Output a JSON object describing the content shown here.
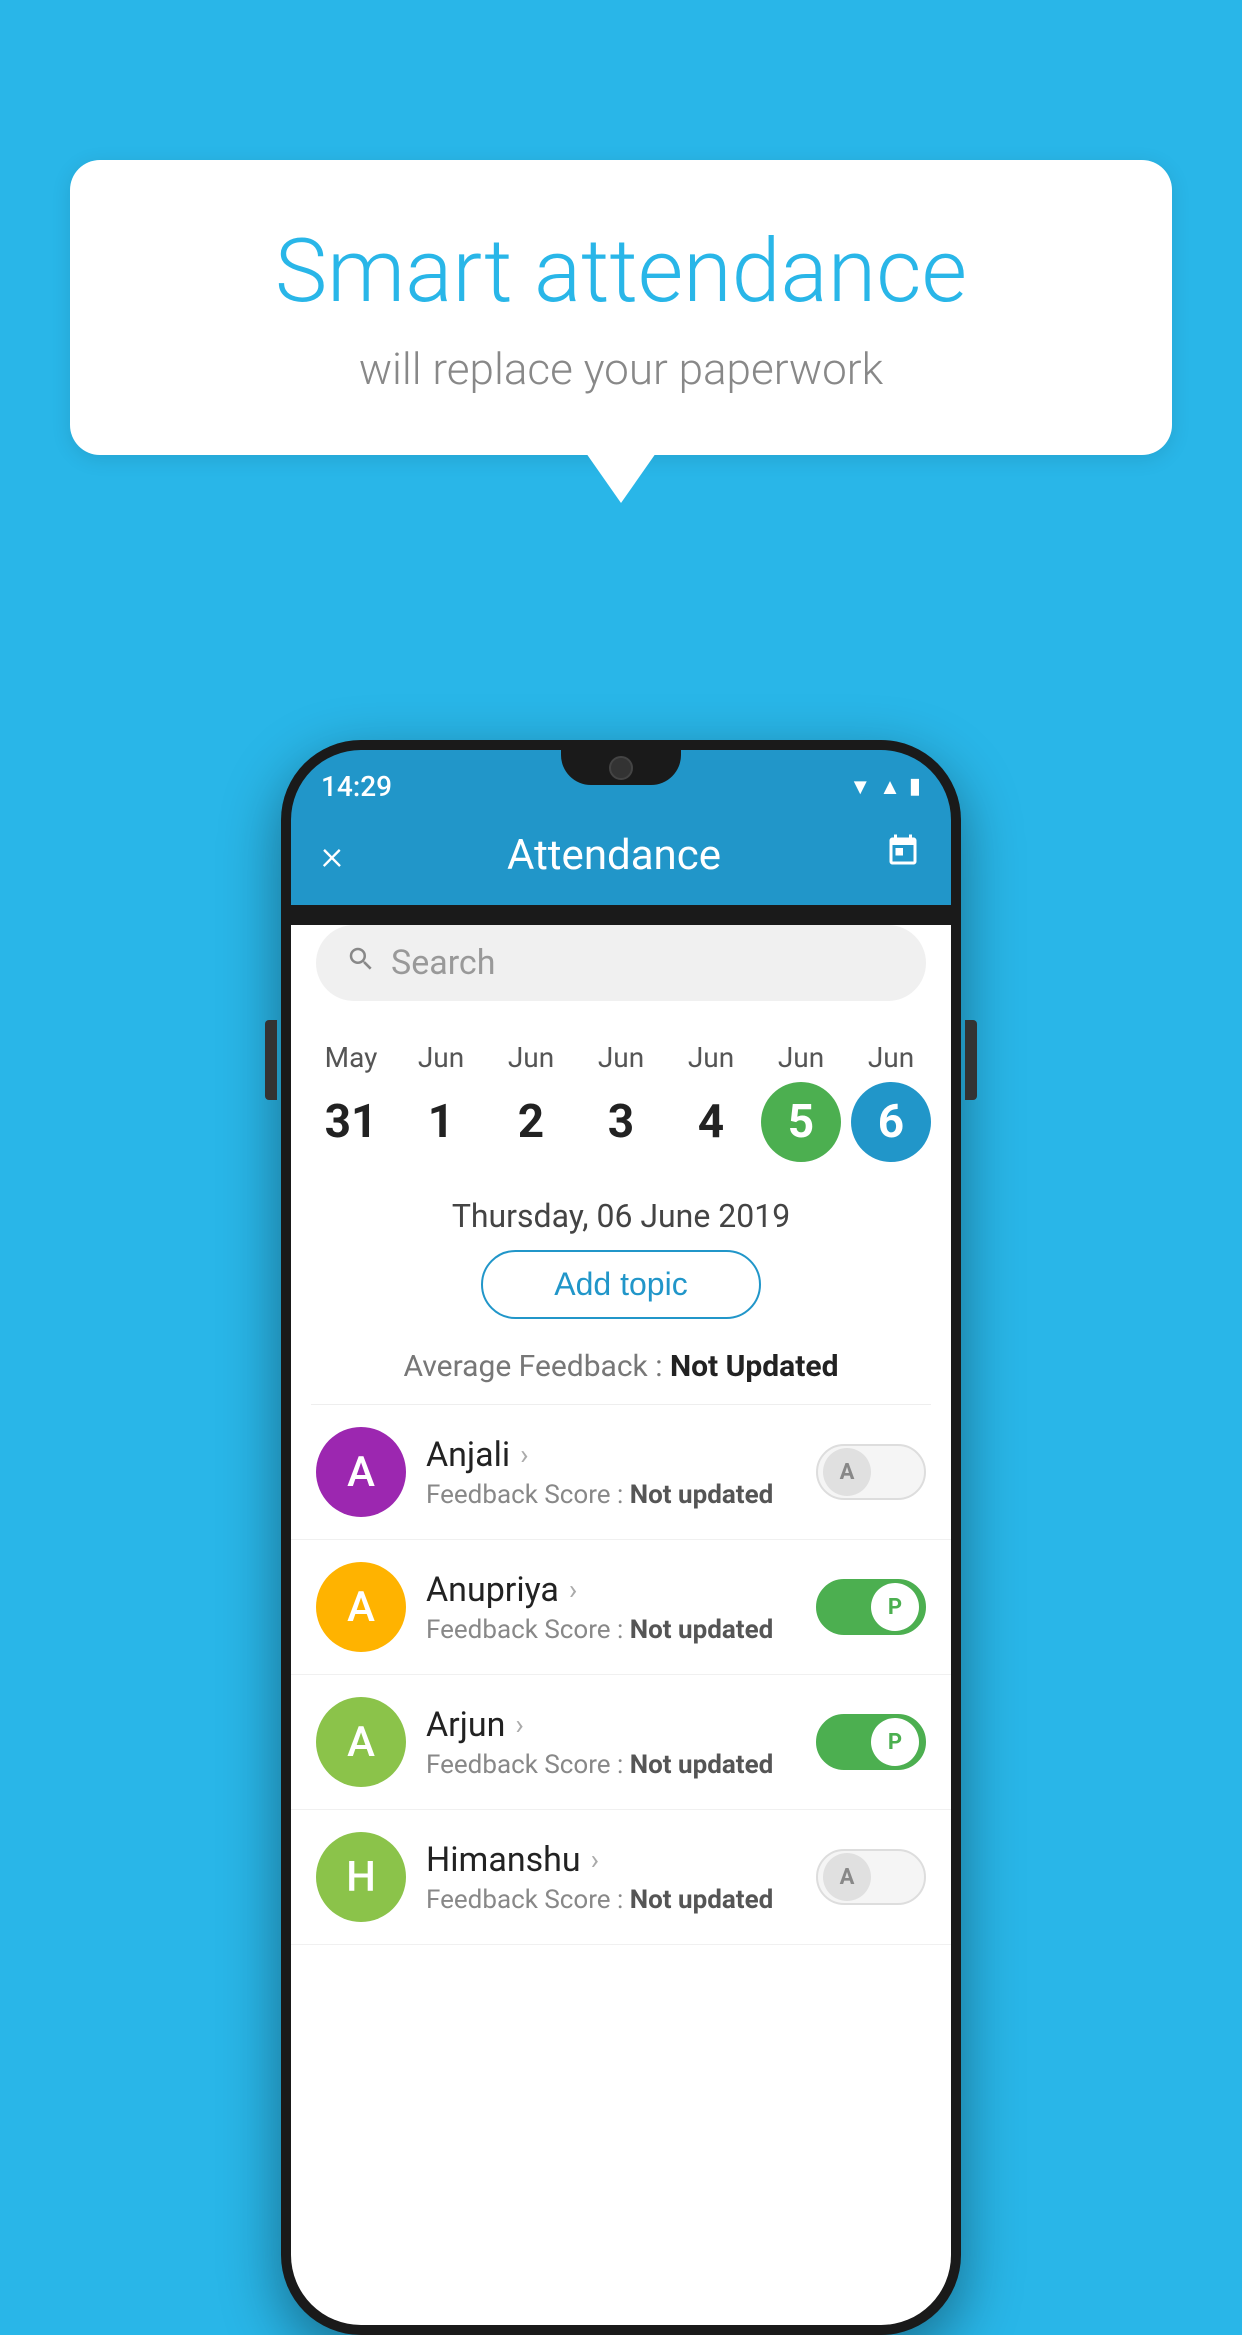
{
  "background_color": "#29b6e8",
  "bubble": {
    "title": "Smart attendance",
    "subtitle": "will replace your paperwork"
  },
  "status_bar": {
    "time": "14:29",
    "wifi_icon": "▼",
    "signal_icon": "▲",
    "battery_icon": "▮"
  },
  "app_bar": {
    "title": "Attendance",
    "close_label": "×",
    "calendar_icon": "📅"
  },
  "search": {
    "placeholder": "Search"
  },
  "calendar": {
    "days": [
      {
        "month": "May",
        "date": "31",
        "state": "normal"
      },
      {
        "month": "Jun",
        "date": "1",
        "state": "normal"
      },
      {
        "month": "Jun",
        "date": "2",
        "state": "normal"
      },
      {
        "month": "Jun",
        "date": "3",
        "state": "normal"
      },
      {
        "month": "Jun",
        "date": "4",
        "state": "normal"
      },
      {
        "month": "Jun",
        "date": "5",
        "state": "today"
      },
      {
        "month": "Jun",
        "date": "6",
        "state": "selected"
      }
    ]
  },
  "date_header": "Thursday, 06 June 2019",
  "add_topic_label": "Add topic",
  "average_feedback_label": "Average Feedback :",
  "average_feedback_value": "Not Updated",
  "students": [
    {
      "name": "Anjali",
      "avatar_letter": "A",
      "avatar_color": "#9c27b0",
      "feedback_label": "Feedback Score :",
      "feedback_value": "Not updated",
      "toggle_state": "off",
      "toggle_letter": "A"
    },
    {
      "name": "Anupriya",
      "avatar_letter": "A",
      "avatar_color": "#ffb300",
      "feedback_label": "Feedback Score :",
      "feedback_value": "Not updated",
      "toggle_state": "on",
      "toggle_letter": "P"
    },
    {
      "name": "Arjun",
      "avatar_letter": "A",
      "avatar_color": "#8bc34a",
      "feedback_label": "Feedback Score :",
      "feedback_value": "Not updated",
      "toggle_state": "on",
      "toggle_letter": "P"
    },
    {
      "name": "Himanshu",
      "avatar_letter": "H",
      "avatar_color": "#8bc34a",
      "feedback_label": "Feedback Score :",
      "feedback_value": "Not updated",
      "toggle_state": "off",
      "toggle_letter": "A"
    }
  ]
}
